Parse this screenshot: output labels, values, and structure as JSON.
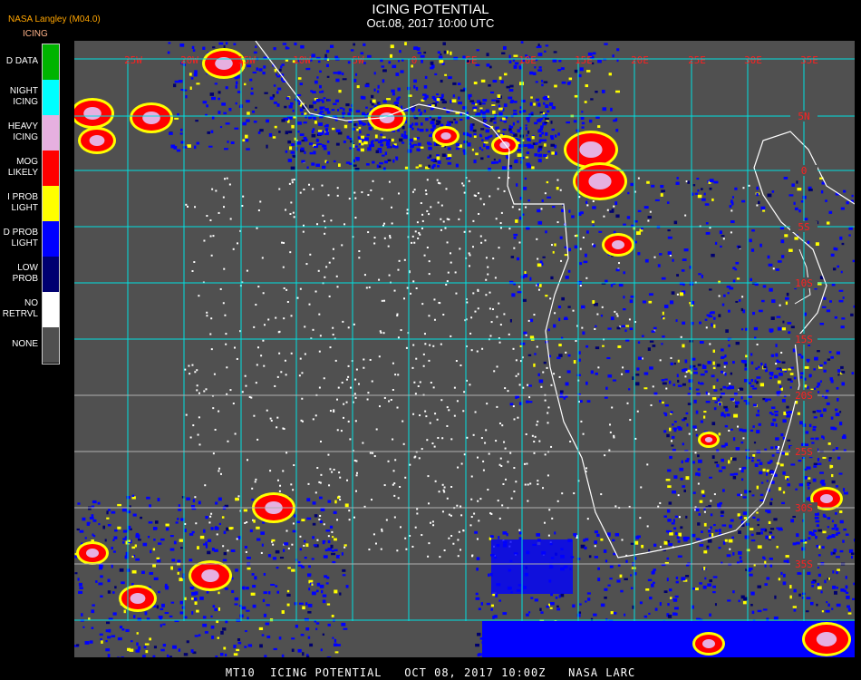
{
  "header": {
    "title": "ICING POTENTIAL",
    "datetime": "Oct.08, 2017 10:00 UTC",
    "source": "NASA Langley (M04.0)",
    "product": "ICING"
  },
  "legend": [
    {
      "label": "D DATA",
      "color": "#00b400"
    },
    {
      "label": "NIGHT\nICING",
      "color": "#00ffff"
    },
    {
      "label": "HEAVY\nICING",
      "color": "#e6b0e0"
    },
    {
      "label": "MOG\nLIKELY",
      "color": "#ff0000"
    },
    {
      "label": "I PROB\nLIGHT",
      "color": "#ffff00"
    },
    {
      "label": "D PROB\nLIGHT",
      "color": "#0000ff"
    },
    {
      "label": "LOW\nPROB",
      "color": "#000070"
    },
    {
      "label": "NO\nRETRVL",
      "color": "#ffffff"
    },
    {
      "label": "NONE",
      "color": "#505050"
    }
  ],
  "map": {
    "longitude_labels": [
      "25W",
      "20W",
      "15W",
      "10W",
      "5W",
      "0",
      "5E",
      "10E",
      "15E",
      "20E",
      "25E",
      "30E",
      "35E"
    ],
    "latitude_labels": [
      "5N",
      "0",
      "5S",
      "10S",
      "15S",
      "20S",
      "25S",
      "30S",
      "35S"
    ]
  },
  "footer": "MT10  ICING POTENTIAL   OCT 08, 2017 10:00Z   NASA LARC"
}
